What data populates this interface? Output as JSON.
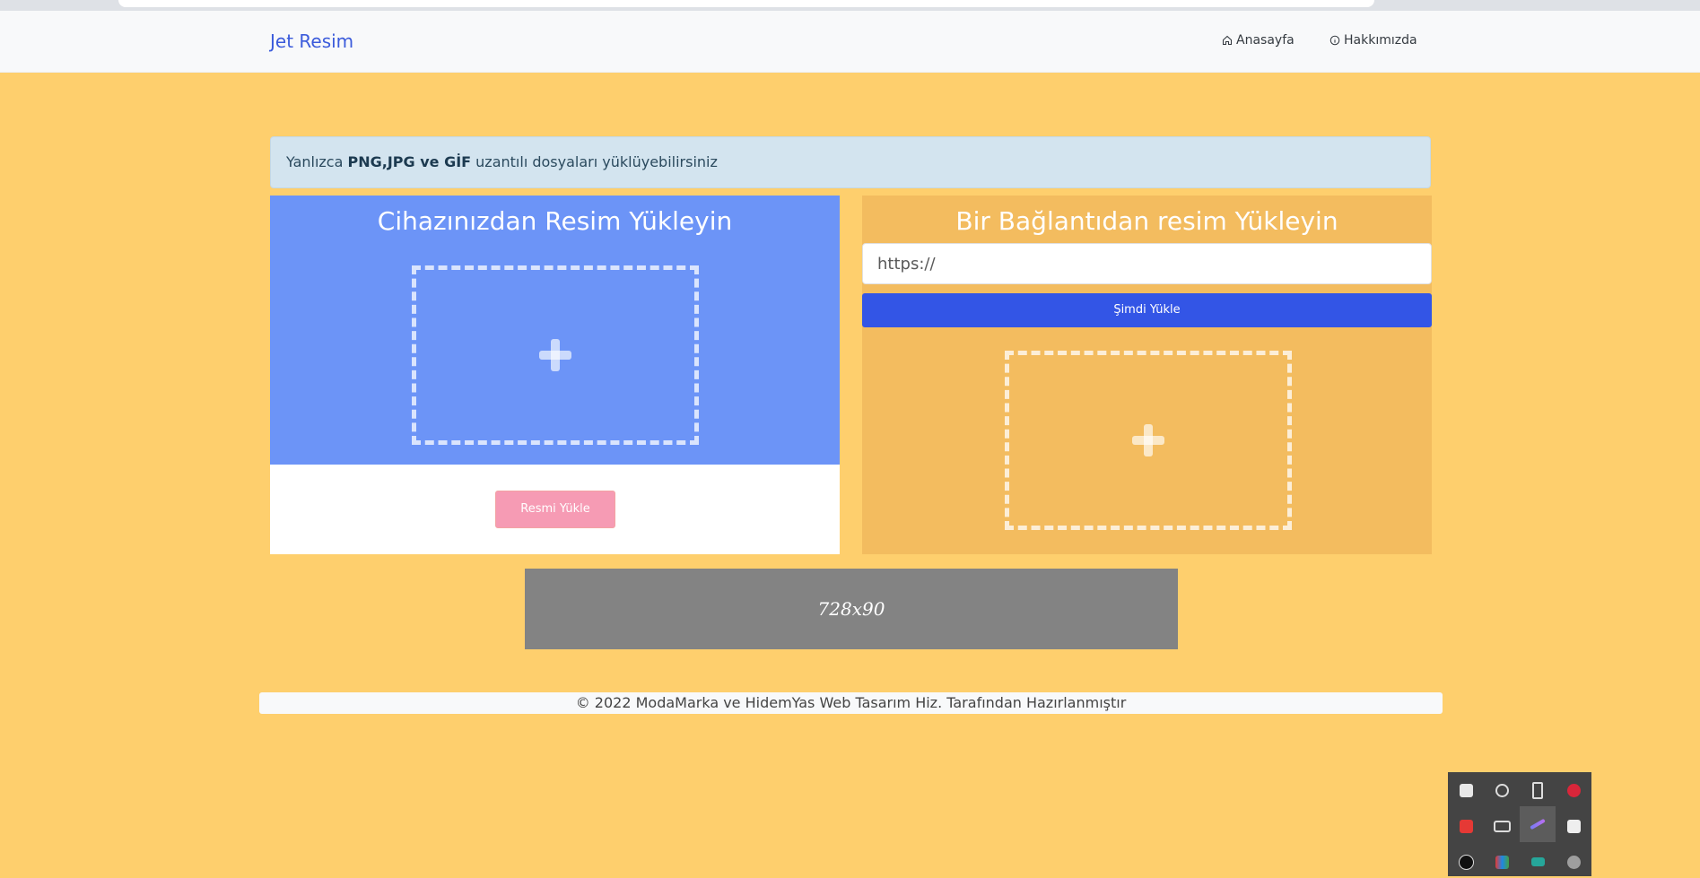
{
  "navbar": {
    "brand": "Jet Resim",
    "links": [
      {
        "label": "Anasayfa",
        "icon": "home-icon"
      },
      {
        "label": "Hakkımızda",
        "icon": "info-icon"
      }
    ]
  },
  "alert": {
    "prefix": "Yanlızca ",
    "bold": "PNG,JPG ve GİF",
    "suffix": " uzantılı dosyaları yüklüyebilirsiniz"
  },
  "device_upload": {
    "title": "Cihazınızdan Resim Yükleyin",
    "button_label": "Resmi Yükle",
    "icon": "plus-icon"
  },
  "link_upload": {
    "title": "Bir Bağlantıdan resim Yükleyin",
    "input_placeholder": "https://",
    "input_value": "",
    "button_label": "Şimdi Yükle",
    "icon": "plus-icon"
  },
  "ad": {
    "label": "728x90"
  },
  "footer": {
    "text": "© 2022 ModaMarka ve HidemYas Web Tasarım Hiz. Tarafından Hazırlanmıştır"
  },
  "tray": {
    "icons": [
      "shield-icon",
      "satellite-icon",
      "usb-icon",
      "bug-icon",
      "record-icon",
      "monitor-icon",
      "feather-icon",
      "drive-icon",
      "logitech-icon",
      "palette-icon",
      "display-icon",
      "skype-icon"
    ]
  },
  "colors": {
    "page_bg": "#fecf6d",
    "brand": "#3b5bdb",
    "device_panel": "#6c94f7",
    "link_panel": "#f3bc5f",
    "primary_button": "#3355e6",
    "upload_button": "#f69bb4",
    "ad_bg": "#838383"
  }
}
